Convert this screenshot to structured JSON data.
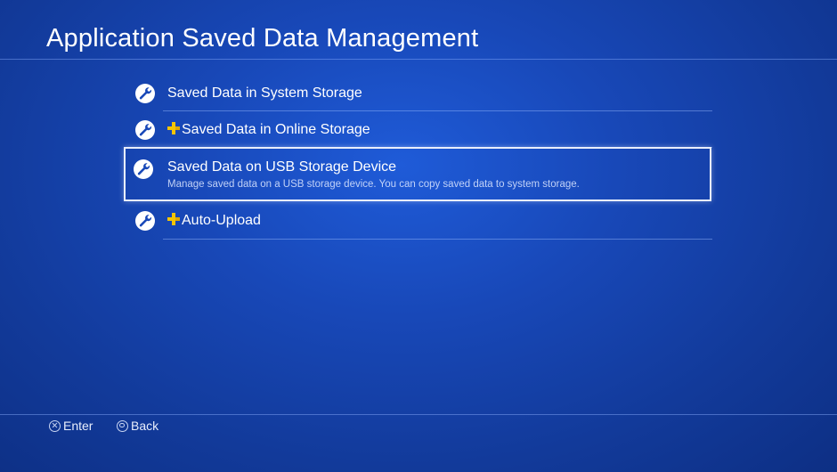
{
  "header": {
    "title": "Application Saved Data Management"
  },
  "menu": {
    "items": [
      {
        "label": "Saved Data in System Storage",
        "icon": "wrench-icon",
        "ps_plus": false
      },
      {
        "label": "Saved Data in Online Storage",
        "icon": "wrench-icon",
        "ps_plus": true
      },
      {
        "label": "Saved Data on USB Storage Device",
        "icon": "wrench-icon",
        "ps_plus": false,
        "selected": true,
        "description": "Manage saved data on a USB storage device. You can copy saved data to system storage."
      },
      {
        "label": "Auto-Upload",
        "icon": "wrench-icon",
        "ps_plus": true
      }
    ]
  },
  "footer": {
    "enter_label": "Enter",
    "enter_icon": "cross-button-icon",
    "back_label": "Back",
    "back_icon": "circle-button-icon"
  },
  "colors": {
    "background": "#1848b8",
    "ps_plus": "#f5c400",
    "text": "#ffffff"
  }
}
